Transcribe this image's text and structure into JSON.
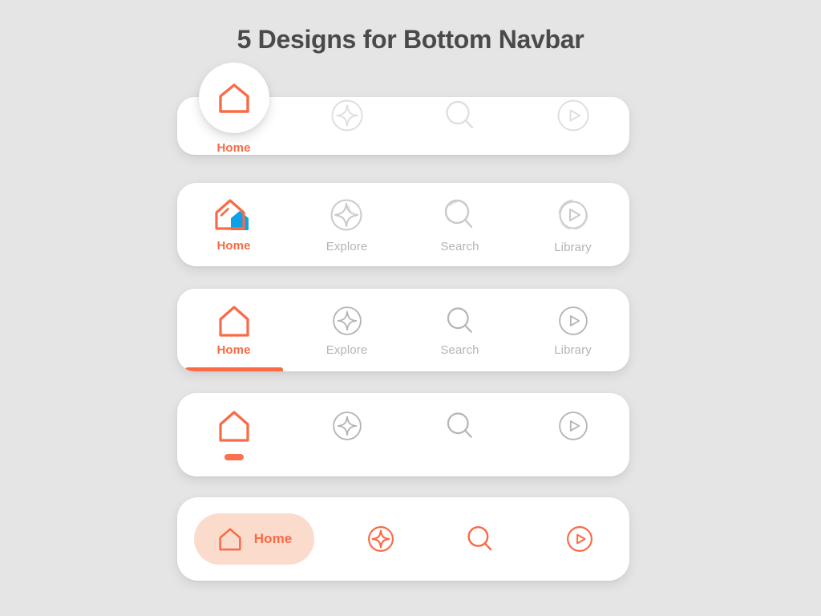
{
  "page": {
    "title": "5 Designs for Bottom Navbar",
    "background_color": "#e5e5e5",
    "accent_color": "#f96a45",
    "accent_soft_color": "#fbdbcc",
    "inactive_color": "#b4b4b4",
    "secondary_accent_color": "#0ca2e8",
    "title_color": "#4a4a4a"
  },
  "navbars": [
    {
      "id": "navbar-raised-circle",
      "style": "raised-active-circle",
      "items": [
        {
          "label": "Home",
          "icon": "home-icon",
          "active": true,
          "show_label": true
        },
        {
          "label": "Explore",
          "icon": "explore-icon",
          "active": false,
          "show_label": false
        },
        {
          "label": "Search",
          "icon": "search-icon",
          "active": false,
          "show_label": false
        },
        {
          "label": "Library",
          "icon": "library-icon",
          "active": false,
          "show_label": false
        }
      ]
    },
    {
      "id": "navbar-animated-icons",
      "style": "animated-morph-icons",
      "items": [
        {
          "label": "Home",
          "icon": "home-icon",
          "active": true,
          "show_label": true
        },
        {
          "label": "Explore",
          "icon": "explore-icon",
          "active": false,
          "show_label": true
        },
        {
          "label": "Search",
          "icon": "search-icon",
          "active": false,
          "show_label": true
        },
        {
          "label": "Library",
          "icon": "library-icon",
          "active": false,
          "show_label": true
        }
      ]
    },
    {
      "id": "navbar-underline",
      "style": "bottom-underline-indicator",
      "items": [
        {
          "label": "Home",
          "icon": "home-icon",
          "active": true,
          "show_label": true
        },
        {
          "label": "Explore",
          "icon": "explore-icon",
          "active": false,
          "show_label": true
        },
        {
          "label": "Search",
          "icon": "search-icon",
          "active": false,
          "show_label": true
        },
        {
          "label": "Library",
          "icon": "library-icon",
          "active": false,
          "show_label": true
        }
      ]
    },
    {
      "id": "navbar-dot",
      "style": "dot-indicator-no-labels",
      "items": [
        {
          "label": "Home",
          "icon": "home-icon",
          "active": true,
          "show_label": false
        },
        {
          "label": "Explore",
          "icon": "explore-icon",
          "active": false,
          "show_label": false
        },
        {
          "label": "Search",
          "icon": "search-icon",
          "active": false,
          "show_label": false
        },
        {
          "label": "Library",
          "icon": "library-icon",
          "active": false,
          "show_label": false
        }
      ]
    },
    {
      "id": "navbar-pill",
      "style": "pill-active-all-accent",
      "items": [
        {
          "label": "Home",
          "icon": "home-icon",
          "active": true,
          "show_label": true
        },
        {
          "label": "Explore",
          "icon": "explore-icon",
          "active": false,
          "show_label": false
        },
        {
          "label": "Search",
          "icon": "search-icon",
          "active": false,
          "show_label": false
        },
        {
          "label": "Library",
          "icon": "library-icon",
          "active": false,
          "show_label": false
        }
      ]
    }
  ]
}
